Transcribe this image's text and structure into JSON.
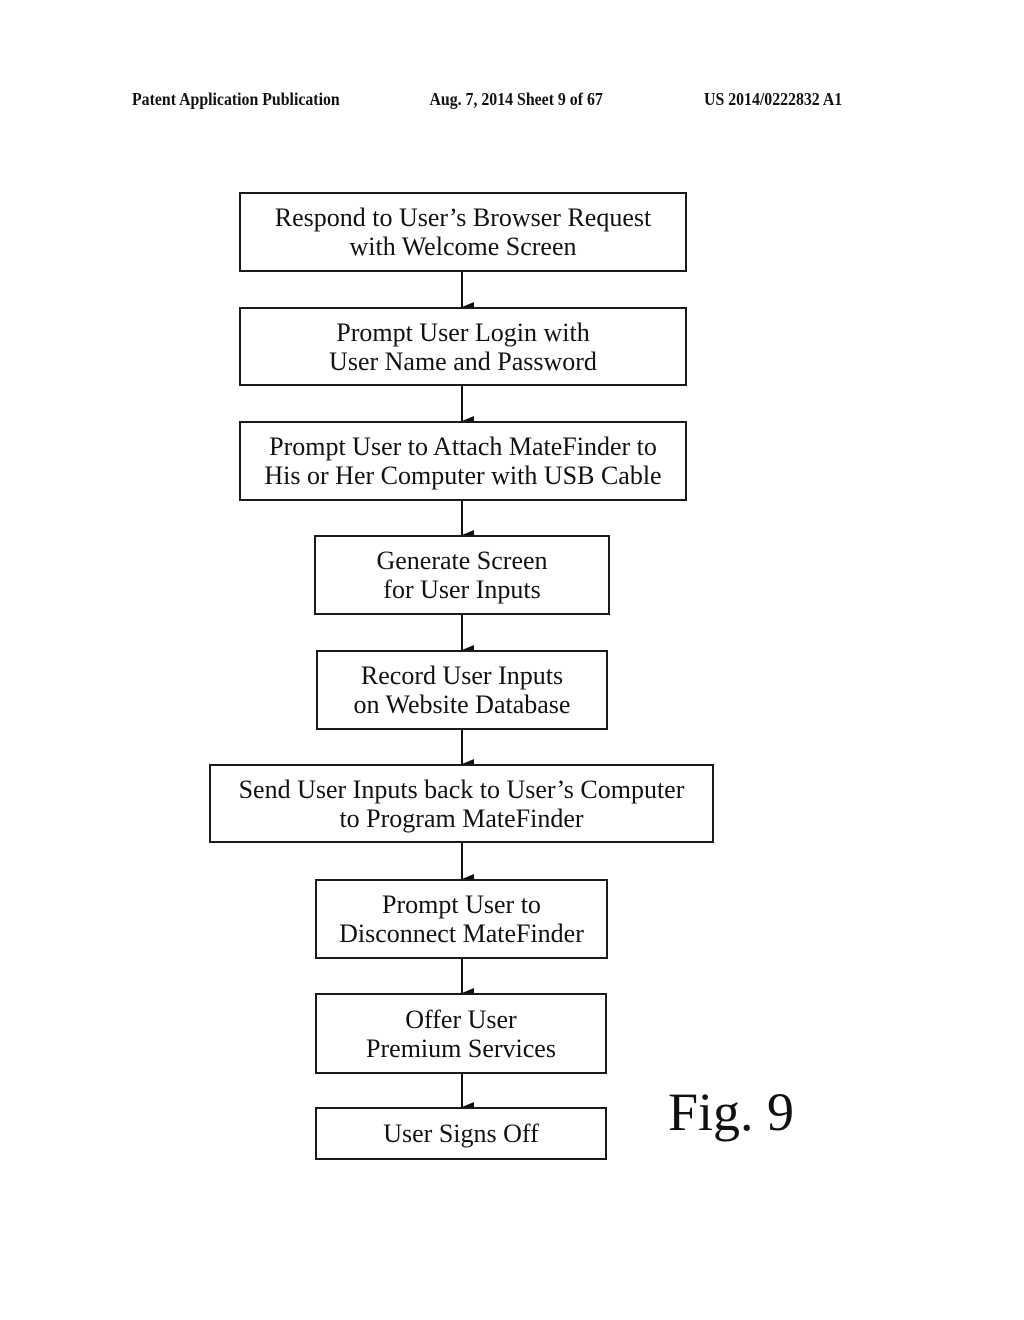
{
  "header": {
    "left": "Patent Application Publication",
    "middle": "Aug. 7, 2014   Sheet 9 of 67",
    "right": "US 2014/0222832 A1"
  },
  "flowchart": {
    "steps": [
      {
        "id": "step-1",
        "text": "Respond to User’s Browser Request\nwith Welcome Screen"
      },
      {
        "id": "step-2",
        "text": "Prompt User Login with\nUser Name and Password"
      },
      {
        "id": "step-3",
        "text": "Prompt User to Attach MateFinder to\nHis or Her Computer with USB Cable"
      },
      {
        "id": "step-4",
        "text": "Generate Screen\nfor User Inputs"
      },
      {
        "id": "step-5",
        "text": "Record User Inputs\non Website Database"
      },
      {
        "id": "step-6",
        "text": "Send User Inputs back to User’s Computer\nto Program MateFinder"
      },
      {
        "id": "step-7",
        "text": "Prompt User to\nDisconnect MateFinder"
      },
      {
        "id": "step-8",
        "text": "Offer User\nPremium Services"
      },
      {
        "id": "step-9",
        "text": "User Signs Off"
      }
    ],
    "edges": [
      [
        "step-1",
        "step-2"
      ],
      [
        "step-2",
        "step-3"
      ],
      [
        "step-3",
        "step-4"
      ],
      [
        "step-4",
        "step-5"
      ],
      [
        "step-5",
        "step-6"
      ],
      [
        "step-6",
        "step-7"
      ],
      [
        "step-7",
        "step-8"
      ],
      [
        "step-8",
        "step-9"
      ]
    ]
  },
  "figure_label": "Fig. 9"
}
